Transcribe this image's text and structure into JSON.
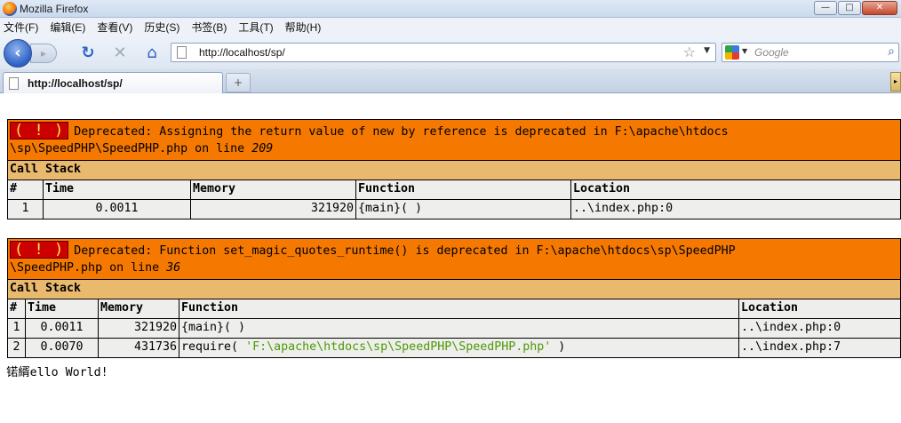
{
  "window": {
    "title": "Mozilla Firefox",
    "controls": {
      "minimize": "—",
      "maximize": "□",
      "close": "✕"
    }
  },
  "menu": [
    "文件(F)",
    "编辑(E)",
    "查看(V)",
    "历史(S)",
    "书签(B)",
    "工具(T)",
    "帮助(H)"
  ],
  "nav": {
    "url": "http://localhost/sp/",
    "search_placeholder": "Google"
  },
  "tab": {
    "label": "http://localhost/sp/",
    "new_tab": "+"
  },
  "errors": [
    {
      "badge": "( ! )",
      "message": "Deprecated: Assigning the return value of new by reference is deprecated in F:\\apache\\htdocs",
      "message2": "\\sp\\SpeedPHP\\SpeedPHP.php on line ",
      "line": "209",
      "call_stack_label": "Call Stack",
      "headers": [
        "#",
        "Time",
        "Memory",
        "Function",
        "Location"
      ],
      "rows": [
        {
          "n": "1",
          "time": "0.0011",
          "memory": "321920",
          "func": "{main}( )",
          "arg": "",
          "func_end": "",
          "location": "..\\index.php:0"
        }
      ]
    },
    {
      "badge": "( ! )",
      "message": "Deprecated: Function set_magic_quotes_runtime() is deprecated in F:\\apache\\htdocs\\sp\\SpeedPHP",
      "message2": "\\SpeedPHP.php on line ",
      "line": "36",
      "call_stack_label": "Call Stack",
      "headers": [
        "#",
        "Time",
        "Memory",
        "Function",
        "Location"
      ],
      "rows": [
        {
          "n": "1",
          "time": "0.0011",
          "memory": "321920",
          "func": "{main}( )",
          "arg": "",
          "func_end": "",
          "location": "..\\index.php:0"
        },
        {
          "n": "2",
          "time": "0.0070",
          "memory": "431736",
          "func": "require( ",
          "arg": "'F:\\apache\\htdocs\\sp\\SpeedPHP\\SpeedPHP.php'",
          "func_end": " )",
          "location": "..\\index.php:7"
        }
      ]
    }
  ],
  "output_text": "锘縃ello World!"
}
